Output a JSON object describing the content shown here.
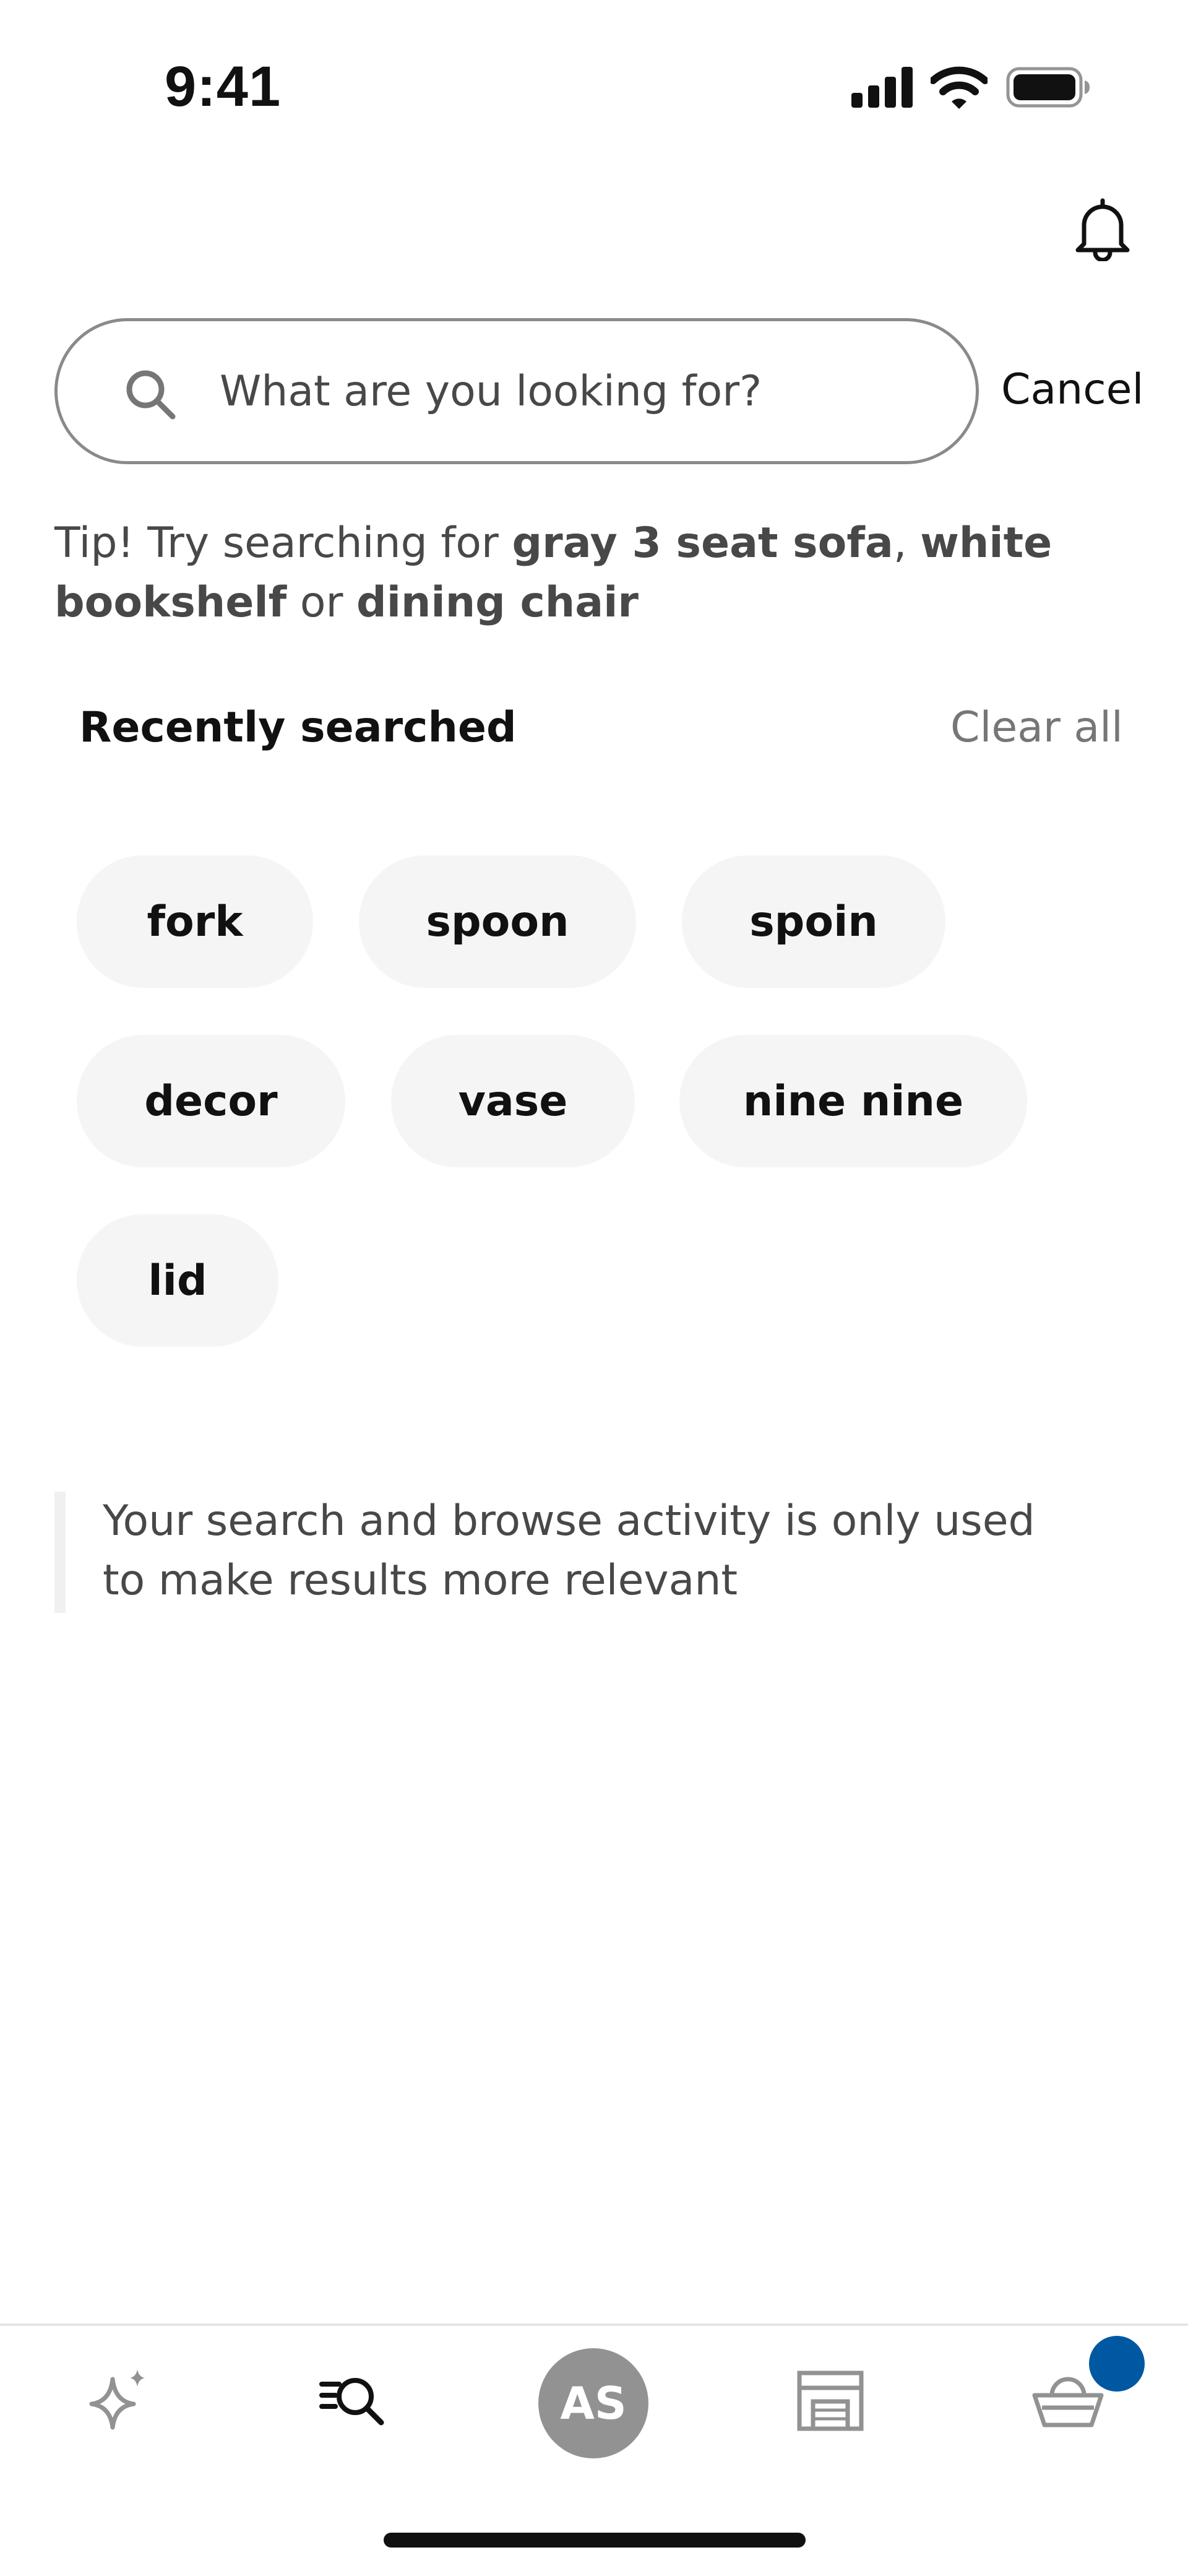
{
  "status_bar": {
    "time": "9:41"
  },
  "search": {
    "placeholder": "What are you looking for?",
    "cancel_label": "Cancel"
  },
  "tip": {
    "prefix": "Tip! Try searching for ",
    "term_1": "gray 3 seat sofa",
    "separator_1": ", ",
    "term_2": "white bookshelf",
    "separator_2": " or ",
    "term_3": "dining chair"
  },
  "recent": {
    "heading": "Recently searched",
    "clear_all_label": "Clear all",
    "items": [
      {
        "label": "fork"
      },
      {
        "label": "spoon"
      },
      {
        "label": "spoin"
      },
      {
        "label": "decor"
      },
      {
        "label": "vase"
      },
      {
        "label": "nine nine"
      },
      {
        "label": "lid"
      }
    ]
  },
  "privacy_note": "Your search and browse activity is only used to make results more relevant",
  "bottom_nav": {
    "items": [
      {
        "icon": "sparkle-icon"
      },
      {
        "icon": "search-list-icon"
      },
      {
        "icon": "avatar",
        "initials": "AS"
      },
      {
        "icon": "store-icon"
      },
      {
        "icon": "basket-icon"
      }
    ],
    "cart_badge_color": "#0058a3"
  },
  "colors": {
    "text_primary": "#111111",
    "text_secondary": "#484848",
    "text_muted": "#767676",
    "chip_bg": "#f5f5f5",
    "accent": "#0058a3"
  }
}
